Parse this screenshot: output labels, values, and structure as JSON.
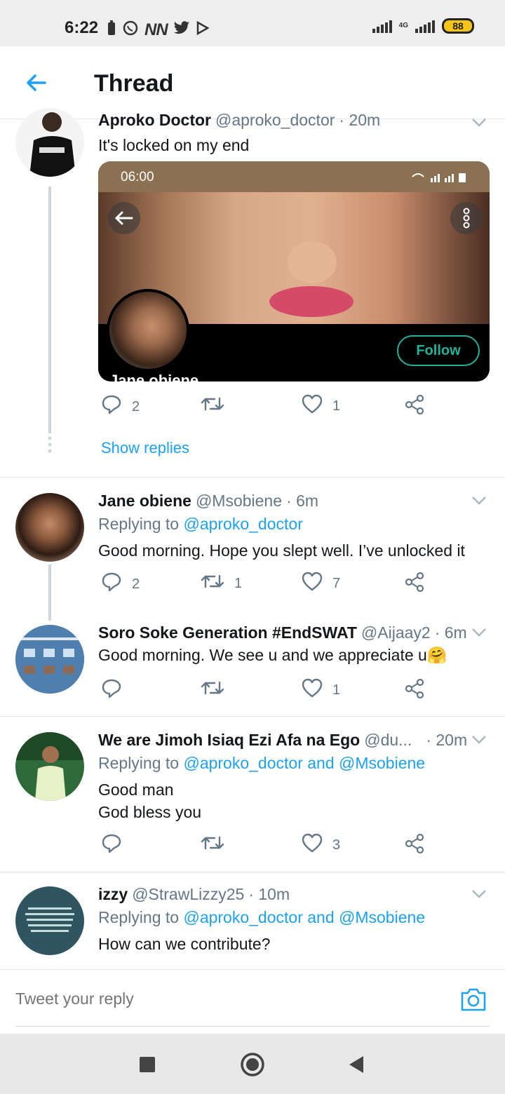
{
  "status_bar": {
    "time": "6:22",
    "network": "4G",
    "battery": "88",
    "notification_icons": [
      "battery-saver-icon",
      "whatsapp-icon",
      "nn-icon",
      "nn-icon",
      "twitter-icon",
      "play-icon"
    ]
  },
  "header": {
    "title": "Thread",
    "back_icon": "back-arrow-icon"
  },
  "colors": {
    "accent": "#1da1f2",
    "secondary_text": "#657786",
    "follow_green": "#1fb39a"
  },
  "thread": [
    {
      "name": "Aproko Doctor",
      "handle": "@aproko_doctor",
      "time": "· 20m",
      "text": "It's locked on my end",
      "embed": {
        "time": "06:00",
        "follow_label": "Follow",
        "profile_name": "Jane obiene"
      },
      "replies": "2",
      "retweets": "",
      "likes": "1",
      "show_replies": "Show replies"
    },
    {
      "name": "Jane obiene",
      "handle": "@Msobiene",
      "time": "· 6m",
      "replying_prefix": "Replying to",
      "replying_to": "@aproko_doctor",
      "text": "Good morning. Hope you slept well. I’ve unlocked it",
      "replies": "2",
      "retweets": "1",
      "likes": "7"
    },
    {
      "name": "Soro Soke Generation #EndSWAT",
      "handle": "@Aijaay2",
      "time": "· 6m",
      "text": "Good morning. We see u and we appreciate u🤗",
      "replies": "",
      "retweets": "",
      "likes": "1"
    },
    {
      "name": "We are Jimoh Isiaq Ezi Afa na Ego",
      "handle": "@du...",
      "time": "· 20m",
      "replying_prefix": "Replying to",
      "replying_to": "@aproko_doctor and @Msobiene",
      "text_line1": "Good man",
      "text_line2": "God bless you",
      "replies": "",
      "retweets": "",
      "likes": "3"
    },
    {
      "name": "izzy",
      "handle": "@StrawLizzy25",
      "time": "· 10m",
      "replying_prefix": "Replying to",
      "replying_to": "@aproko_doctor and @Msobiene",
      "text": "How can we contribute?"
    }
  ],
  "reply_bar": {
    "placeholder": "Tweet your reply",
    "camera_icon": "camera-icon"
  },
  "nav_bar": {
    "icons": [
      "recents-square-icon",
      "home-circle-icon",
      "back-triangle-icon"
    ]
  }
}
